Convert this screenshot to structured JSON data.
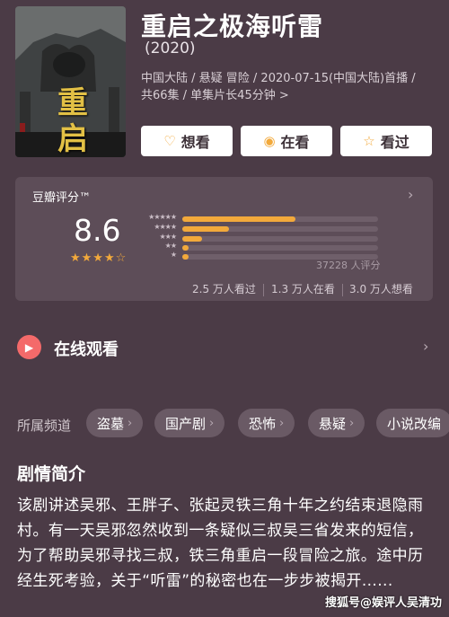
{
  "show": {
    "title": "重启之极海听雷",
    "year": "(2020)",
    "meta_line1": "中国大陆 / 悬疑 冒险 / 2020-07-15(中国大陆)首播 /",
    "meta_line2": "共66集 / 单集片长45分钟 >",
    "poster_title_line1": "重",
    "poster_title_line2": "启"
  },
  "actions": {
    "want": "想看",
    "watching": "在看",
    "watched": "看过"
  },
  "rating": {
    "label": "豆瓣评分™",
    "score": "8.6",
    "stars": "★★★★☆",
    "distribution": [
      {
        "stars": "★★★★★",
        "fraction": 0.58
      },
      {
        "stars": "★★★★",
        "fraction": 0.24
      },
      {
        "stars": "★★★",
        "fraction": 0.1
      },
      {
        "stars": "★★",
        "fraction": 0.03
      },
      {
        "stars": "★",
        "fraction": 0.03
      }
    ],
    "count": "37228 人评分",
    "watched_count": "2.5 万人看过",
    "watching_count": "1.3 万人在看",
    "want_count": "3.0 万人想看"
  },
  "watch_online": {
    "label": "在线观看"
  },
  "channels": {
    "label": "所属频道",
    "items": [
      "盗墓",
      "国产剧",
      "恐怖",
      "悬疑",
      "小说改编"
    ]
  },
  "synopsis": {
    "title": "剧情简介",
    "text": "该剧讲述吴邪、王胖子、张起灵铁三角十年之约结束退隐雨村。有一天吴邪忽然收到一条疑似三叔吴三省发来的短信，为了帮助吴邪寻找三叔，铁三角重启一段冒险之旅。途中历经生死考验，关于“听雷”的秘密也在一步步被揭开......"
  },
  "watermark": "搜狐号@娱评人吴清功",
  "colors": {
    "background": "#4b3b46",
    "card": "#5d4d58",
    "accent": "#f2a93b",
    "play": "#f46a6a"
  }
}
